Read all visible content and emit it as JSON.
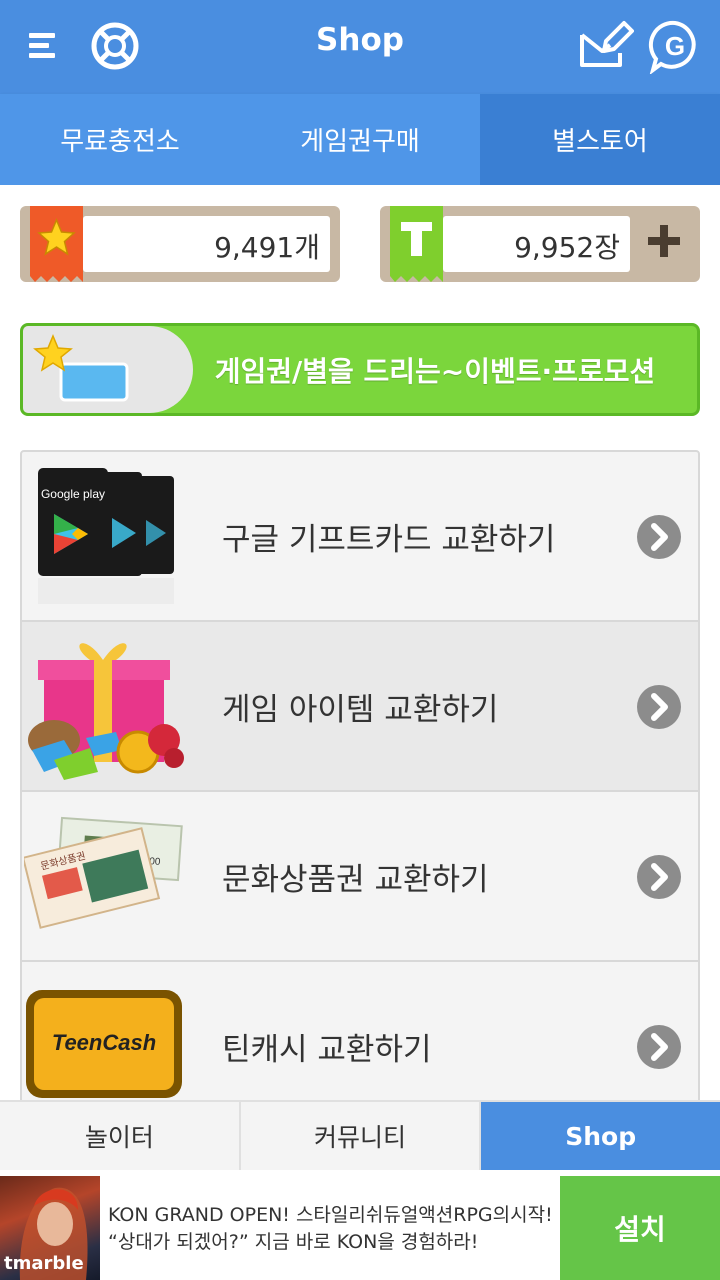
{
  "header": {
    "title": "Shop",
    "menu_icon": "hamburger-menu-icon",
    "lifebuoy_icon": "lifebuoy-icon",
    "message_icon": "edit-mail-icon",
    "g_icon": "g-chat-icon"
  },
  "tabs": [
    {
      "label": "무료충전소",
      "active": false
    },
    {
      "label": "게임권구매",
      "active": false
    },
    {
      "label": "별스토어",
      "active": true
    }
  ],
  "balances": {
    "stars": {
      "value": "9,491개",
      "icon": "star-icon"
    },
    "tickets": {
      "value": "9,952장",
      "icon": "ticket-t-icon",
      "add_icon": "plus-icon"
    }
  },
  "promo": {
    "text": "게임권/별을 드리는~이벤트·프로모션"
  },
  "items": [
    {
      "label": "구글 기프트카드 교환하기",
      "thumb": "google-play-card-icon",
      "card_text": "Google play",
      "arrow": "chevron-right-icon"
    },
    {
      "label": "게임 아이템 교환하기",
      "thumb": "gift-box-gems-icon",
      "arrow": "chevron-right-icon"
    },
    {
      "label": "문화상품권 교환하기",
      "thumb": "culture-voucher-icon",
      "voucher_text": "문화상품권",
      "voucher_amount": "₩5,000",
      "arrow": "chevron-right-icon"
    },
    {
      "label": "틴캐시 교환하기",
      "thumb": "teencash-card-icon",
      "card_text": "TeenCash",
      "arrow": "chevron-right-icon"
    }
  ],
  "bottom_nav": [
    {
      "label": "놀이터",
      "active": false
    },
    {
      "label": "커뮤니티",
      "active": false
    },
    {
      "label": "Shop",
      "active": true
    }
  ],
  "ad": {
    "brand": "tmarble",
    "line1": "KON GRAND OPEN! 스타일리쉬듀얼액션RPG의시작!",
    "line2": "“상대가 되겠어?” 지금 바로 KON을 경험하라!",
    "install_label": "설치"
  },
  "colors": {
    "header_blue": "#4a8ee0",
    "tab_active_blue": "#3a7fd3",
    "promo_green": "#7bd63c",
    "install_green": "#65c548"
  }
}
